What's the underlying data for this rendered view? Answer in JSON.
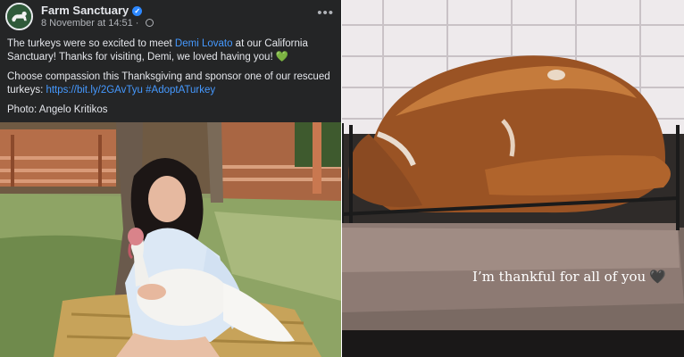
{
  "post": {
    "page_name": "Farm Sanctuary",
    "timestamp": "8 November at 14:51",
    "more_label": "•••",
    "text1_a": "The turkeys were so excited to meet ",
    "text1_link": "Demi Lovato",
    "text1_b": " at our California Sanctuary! Thanks for visiting, Demi, we loved having you!",
    "text1_emoji": "💚",
    "text2_a": "Choose compassion this Thanksgiving and sponsor one of our rescued turkeys: ",
    "text2_link": "https://bit.ly/2GAvTyu",
    "text2_tag": "#AdoptATurkey",
    "text3": "Photo: Angelo Kritikos"
  },
  "story": {
    "caption": "I’m thankful for all of you",
    "emoji": "🖤"
  },
  "colors": {
    "fb_bg": "#242526",
    "link": "#4599ff",
    "text": "#e4e6eb",
    "meta": "#b0b3b8"
  }
}
